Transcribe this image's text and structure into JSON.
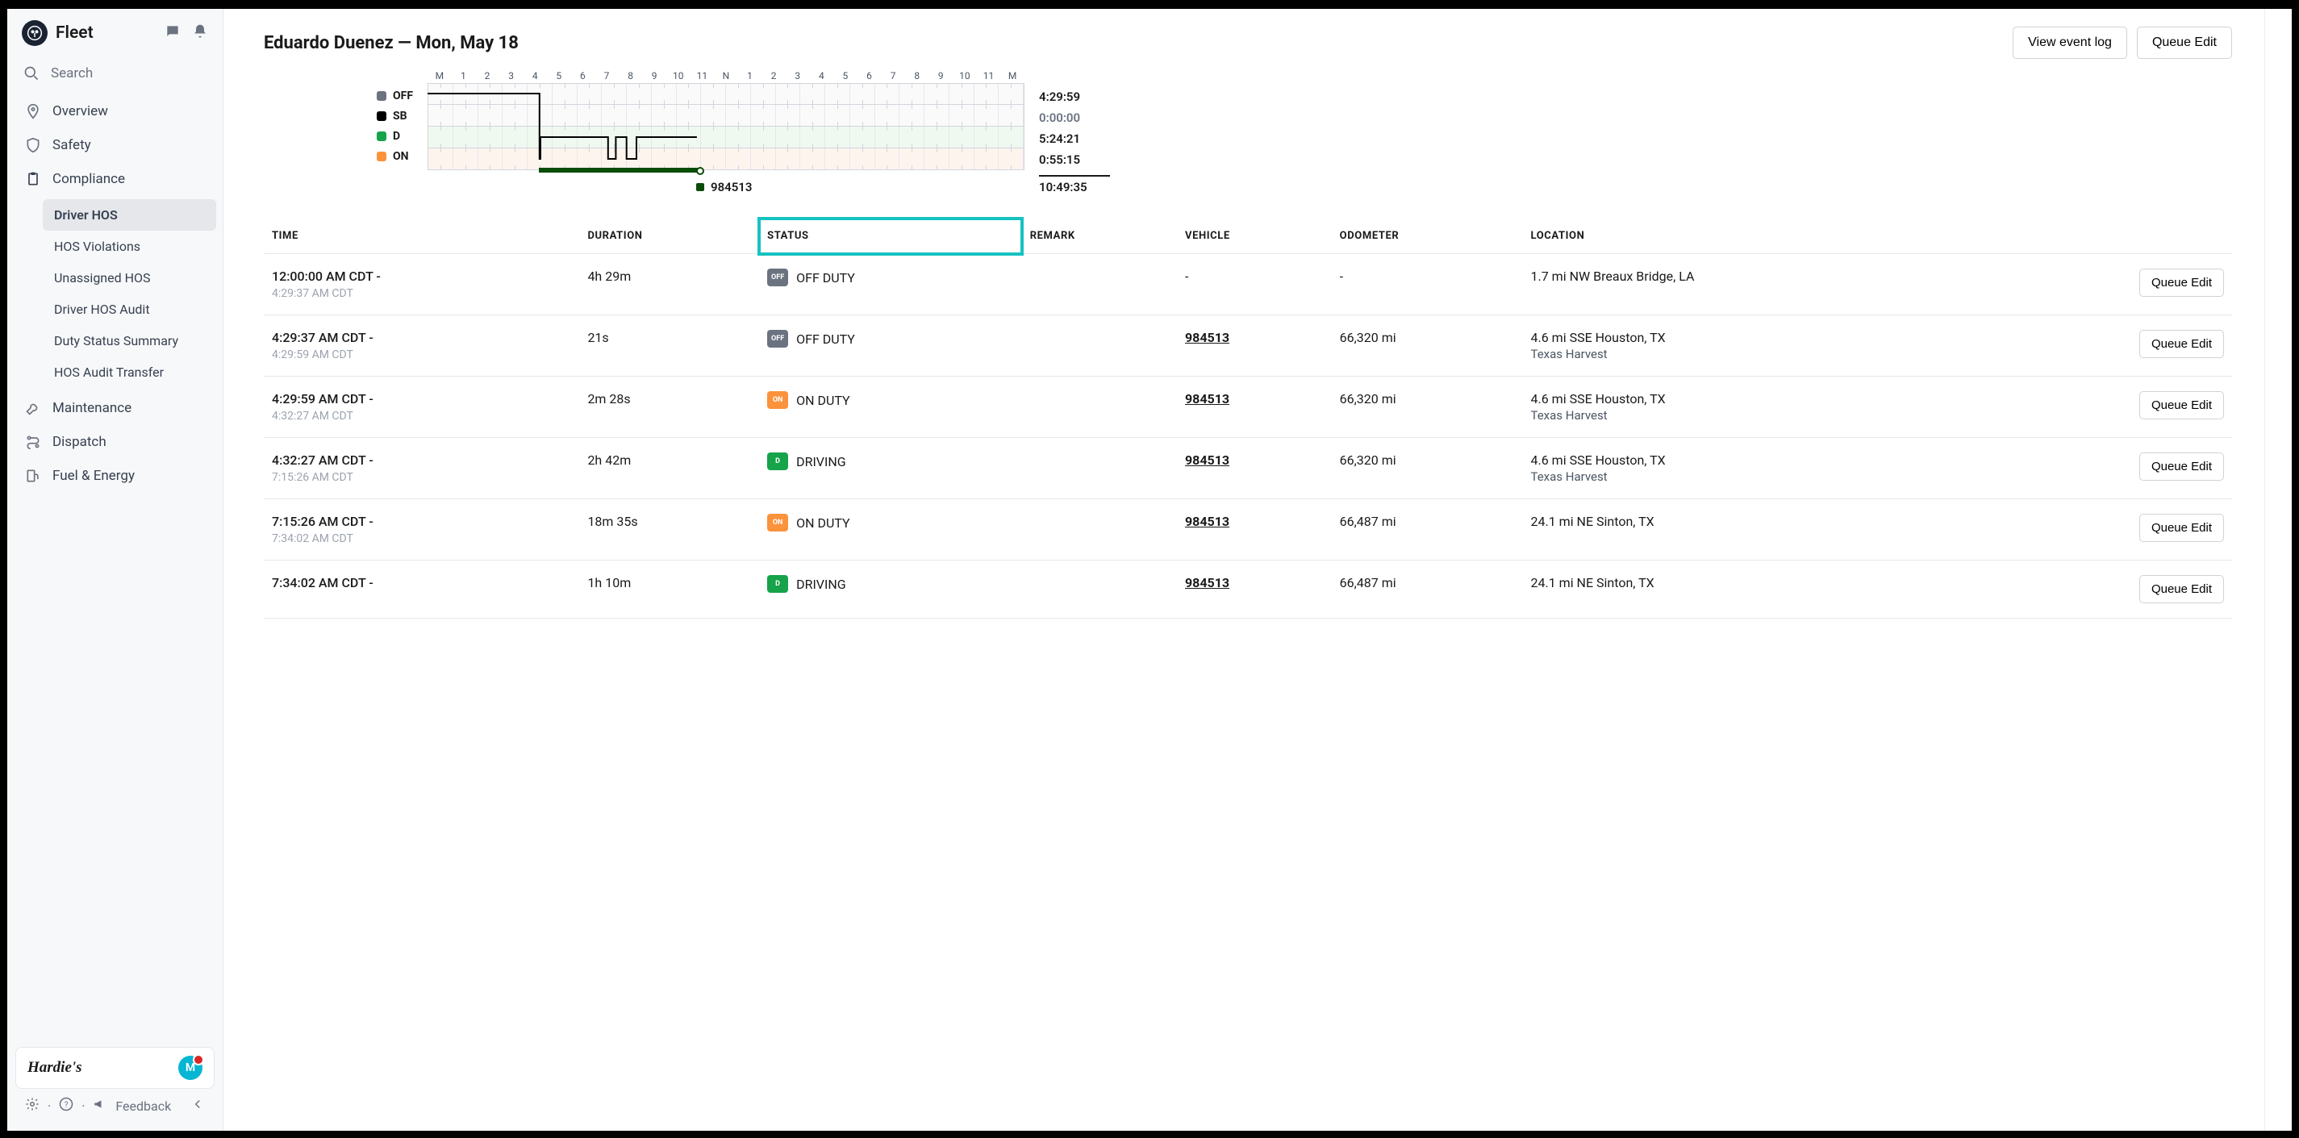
{
  "app": {
    "title": "Fleet"
  },
  "search": {
    "placeholder": "Search"
  },
  "sidebar": {
    "items": [
      {
        "label": "Overview"
      },
      {
        "label": "Safety"
      },
      {
        "label": "Compliance"
      },
      {
        "label": "Maintenance"
      },
      {
        "label": "Dispatch"
      },
      {
        "label": "Fuel & Energy"
      }
    ],
    "compliance_sub": [
      {
        "label": "Driver HOS"
      },
      {
        "label": "HOS Violations"
      },
      {
        "label": "Unassigned HOS"
      },
      {
        "label": "Driver HOS Audit"
      },
      {
        "label": "Duty Status Summary"
      },
      {
        "label": "HOS Audit Transfer"
      }
    ]
  },
  "org": {
    "name": "Hardie's",
    "avatar_initial": "M"
  },
  "footer": {
    "feedback": "Feedback"
  },
  "header": {
    "title": "Eduardo Duenez — Mon, May 18",
    "view_event_log": "View event log",
    "queue_edit": "Queue Edit"
  },
  "chart": {
    "ticks": [
      "M",
      "1",
      "2",
      "3",
      "4",
      "5",
      "6",
      "7",
      "8",
      "9",
      "10",
      "11",
      "N",
      "1",
      "2",
      "3",
      "4",
      "5",
      "6",
      "7",
      "8",
      "9",
      "10",
      "11",
      "M"
    ],
    "legend": [
      {
        "code": "OFF",
        "color": "#6b7280"
      },
      {
        "code": "SB",
        "color": "#000000"
      },
      {
        "code": "D",
        "color": "#16a34a"
      },
      {
        "code": "ON",
        "color": "#fb923c"
      }
    ],
    "totals": {
      "off": "4:29:59",
      "sb": "0:00:00",
      "d": "5:24:21",
      "on": "0:55:15",
      "grand": "10:49:35"
    },
    "vehicle_marker": "984513"
  },
  "columns": {
    "time": "TIME",
    "duration": "DURATION",
    "status": "STATUS",
    "remark": "REMARK",
    "vehicle": "VEHICLE",
    "odometer": "ODOMETER",
    "location": "LOCATION"
  },
  "row_button": "Queue Edit",
  "log": [
    {
      "time_start": "12:00:00 AM CDT -",
      "time_end": "4:29:37 AM CDT",
      "duration": "4h 29m",
      "status_code": "OFF",
      "status_label": "OFF DUTY",
      "badge_class": "sb-off",
      "vehicle": "-",
      "odometer": "-",
      "location": "1.7 mi NW Breaux Bridge, LA",
      "location2": ""
    },
    {
      "time_start": "4:29:37 AM CDT -",
      "time_end": "4:29:59 AM CDT",
      "duration": "21s",
      "status_code": "OFF",
      "status_label": "OFF DUTY",
      "badge_class": "sb-off",
      "vehicle": "984513",
      "odometer": "66,320 mi",
      "location": "4.6 mi SSE Houston, TX",
      "location2": "Texas Harvest"
    },
    {
      "time_start": "4:29:59 AM CDT -",
      "time_end": "4:32:27 AM CDT",
      "duration": "2m 28s",
      "status_code": "ON",
      "status_label": "ON DUTY",
      "badge_class": "sb-on",
      "vehicle": "984513",
      "odometer": "66,320 mi",
      "location": "4.6 mi SSE Houston, TX",
      "location2": "Texas Harvest"
    },
    {
      "time_start": "4:32:27 AM CDT -",
      "time_end": "7:15:26 AM CDT",
      "duration": "2h 42m",
      "status_code": "D",
      "status_label": "DRIVING",
      "badge_class": "sb-d",
      "vehicle": "984513",
      "odometer": "66,320 mi",
      "location": "4.6 mi SSE Houston, TX",
      "location2": "Texas Harvest"
    },
    {
      "time_start": "7:15:26 AM CDT -",
      "time_end": "7:34:02 AM CDT",
      "duration": "18m 35s",
      "status_code": "ON",
      "status_label": "ON DUTY",
      "badge_class": "sb-on",
      "vehicle": "984513",
      "odometer": "66,487 mi",
      "location": "24.1 mi NE Sinton, TX",
      "location2": ""
    },
    {
      "time_start": "7:34:02 AM CDT -",
      "time_end": "",
      "duration": "1h 10m",
      "status_code": "D",
      "status_label": "DRIVING",
      "badge_class": "sb-d",
      "vehicle": "984513",
      "odometer": "66,487 mi",
      "location": "24.1 mi NE Sinton, TX",
      "location2": ""
    }
  ],
  "chart_data": {
    "type": "timeline",
    "rows": [
      "OFF",
      "SB",
      "D",
      "ON"
    ],
    "x_range_hours": [
      0,
      24
    ],
    "segments": [
      {
        "status": "OFF",
        "start_h": 0.0,
        "end_h": 4.5
      },
      {
        "status": "ON",
        "start_h": 4.5,
        "end_h": 4.54
      },
      {
        "status": "D",
        "start_h": 4.54,
        "end_h": 7.26
      },
      {
        "status": "ON",
        "start_h": 7.26,
        "end_h": 7.57
      },
      {
        "status": "D",
        "start_h": 7.57,
        "end_h": 8.0
      },
      {
        "status": "ON",
        "start_h": 8.0,
        "end_h": 8.4
      },
      {
        "status": "D",
        "start_h": 8.4,
        "end_h": 10.83
      }
    ],
    "vehicle_span": {
      "vehicle": "984513",
      "start_h": 4.5,
      "end_h": 10.83
    }
  }
}
